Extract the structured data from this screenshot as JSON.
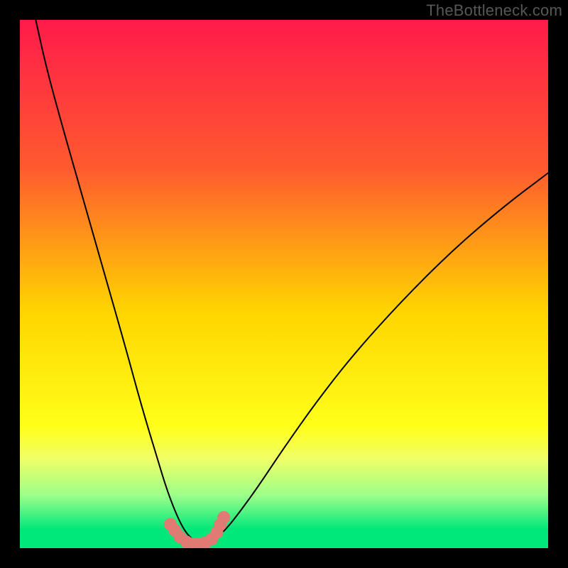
{
  "watermark": "TheBottleneck.com",
  "chart_data": {
    "type": "line",
    "title": "",
    "xlabel": "",
    "ylabel": "",
    "xlim": [
      0,
      100
    ],
    "ylim": [
      0,
      100
    ],
    "background_gradient": {
      "stops": [
        {
          "offset": 0.0,
          "color": "#ff1b4a"
        },
        {
          "offset": 0.28,
          "color": "#ff5a2f"
        },
        {
          "offset": 0.55,
          "color": "#ffd400"
        },
        {
          "offset": 0.77,
          "color": "#ffff1a"
        },
        {
          "offset": 0.83,
          "color": "#f1ff66"
        },
        {
          "offset": 0.9,
          "color": "#9cff8a"
        },
        {
          "offset": 0.965,
          "color": "#00e77a"
        },
        {
          "offset": 1.0,
          "color": "#00e77a"
        }
      ]
    },
    "series": [
      {
        "name": "bottleneck-curve",
        "color": "#000000",
        "stroke_width": 2,
        "x": [
          3.0,
          5.0,
          8.0,
          12.0,
          16.0,
          20.0,
          23.0,
          26.0,
          28.0,
          30.0,
          31.5,
          33.0,
          34.0,
          35.0,
          36.5,
          38.5,
          41.0,
          45.0,
          50.0,
          56.0,
          63.0,
          72.0,
          82.0,
          92.0,
          100.0
        ],
        "y": [
          100.0,
          91.0,
          80.0,
          66.0,
          52.0,
          38.0,
          27.0,
          17.0,
          10.5,
          5.5,
          2.8,
          1.4,
          1.0,
          1.0,
          1.5,
          3.0,
          6.0,
          11.5,
          19.0,
          27.5,
          36.5,
          46.5,
          56.5,
          65.0,
          71.0
        ]
      },
      {
        "name": "bottleneck-markers",
        "color": "#e17a72",
        "marker_radius": 9,
        "x": [
          28.5,
          29.3,
          30.3,
          31.5,
          32.7,
          33.9,
          35.1,
          36.3,
          37.3,
          37.9,
          38.6
        ],
        "y": [
          4.5,
          3.4,
          2.1,
          1.2,
          0.8,
          0.8,
          1.0,
          1.7,
          3.0,
          4.4,
          5.8
        ]
      }
    ]
  }
}
